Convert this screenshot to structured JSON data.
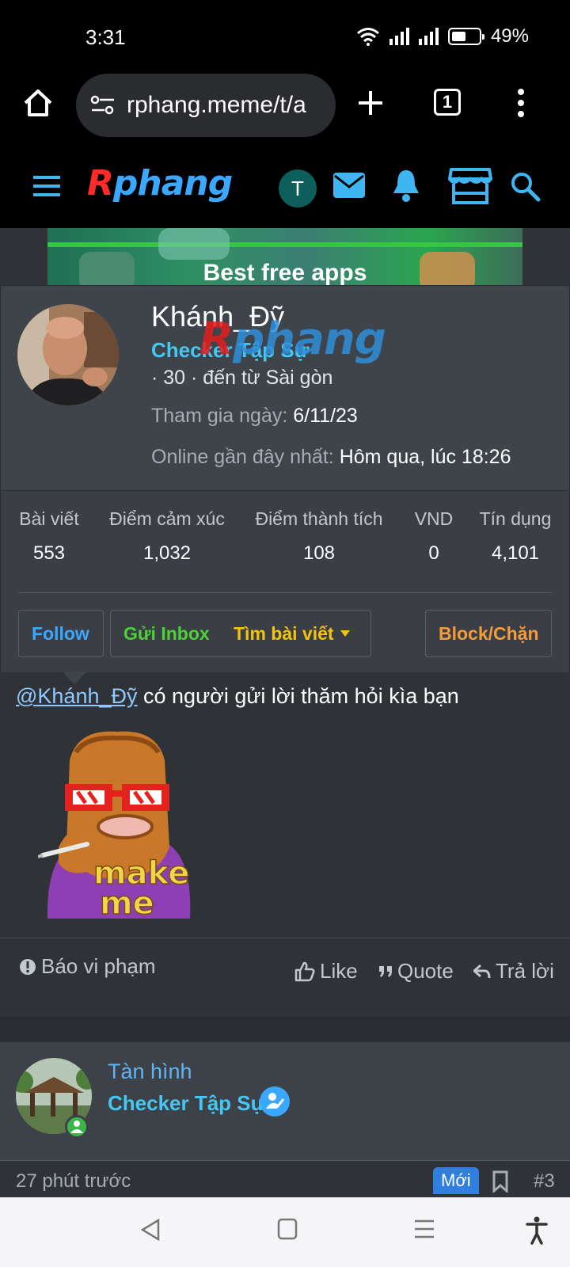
{
  "status": {
    "time": "3:31",
    "battery": "49%"
  },
  "browser": {
    "url": "rphang.meme/t/a",
    "tab_count": "1"
  },
  "site": {
    "logo_r": "R",
    "logo_rest": "phang",
    "user_initial": "T"
  },
  "banner": {
    "title": "Best free apps"
  },
  "profile": {
    "name": "Khánh_Đỹ",
    "rank": "Checker Tập Sự",
    "meta": "· 30 · đến từ Sài gòn",
    "joined_label": "Tham gia ngày:",
    "joined_value": "6/11/23",
    "online_label": "Online gần đây nhất:",
    "online_value": "Hôm qua, lúc 18:26",
    "stats": [
      {
        "label": "Bài viết",
        "value": "553"
      },
      {
        "label": "Điểm cảm xúc",
        "value": "1,032"
      },
      {
        "label": "Điểm thành tích",
        "value": "108"
      },
      {
        "label": "VND",
        "value": "0"
      },
      {
        "label": "Tín dụng",
        "value": "4,101"
      }
    ],
    "buttons": {
      "follow": "Follow",
      "inbox": "Gửi Inbox",
      "find_posts": "Tìm bài viết",
      "block": "Block/Chặn"
    }
  },
  "post": {
    "mention": "@Khánh_Đỹ",
    "text": "có người gửi lời thăm hỏi kìa bạn",
    "sticker_text_1": "make",
    "sticker_text_2": "me",
    "actions": {
      "report": "Báo vi phạm",
      "like": "Like",
      "quote": "Quote",
      "reply": "Trả lời"
    }
  },
  "next_post": {
    "name": "Tàn hình",
    "rank": "Checker Tập Sự",
    "time": "27 phút trước",
    "badge": "Mới",
    "number": "#3"
  },
  "colors": {
    "accent_blue": "#45c7f2",
    "follow": "#3aa8ff",
    "inbox": "#4cd137",
    "find": "#f1c40f",
    "block": "#f39c3c"
  }
}
